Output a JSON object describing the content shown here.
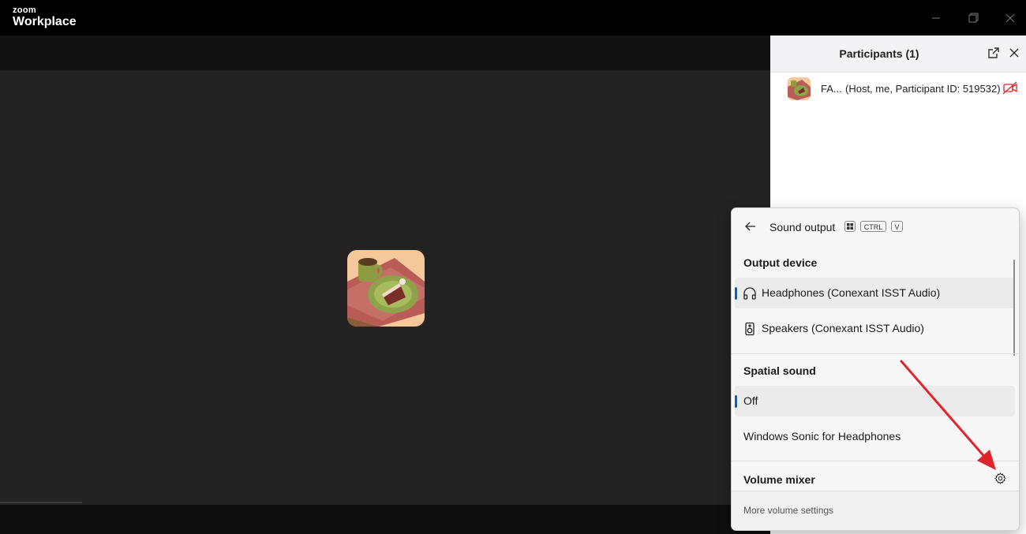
{
  "app": {
    "brand_top": "zoom",
    "brand_bottom": "Workplace"
  },
  "window_controls": {
    "minimize_icon": "minimize-icon",
    "restore_icon": "restore-icon",
    "close_icon": "close-icon"
  },
  "participants": {
    "title": "Participants (1)",
    "list": [
      {
        "name": "FA...",
        "role": "(Host, me, Participant ID: 519532)",
        "video_icon": "video-off-icon"
      }
    ]
  },
  "sound_output": {
    "title": "Sound output",
    "shortcut": [
      "CTRL",
      "V"
    ],
    "output_device_heading": "Output device",
    "devices": [
      {
        "label": "Headphones (Conexant ISST Audio)",
        "icon": "headphones-icon",
        "selected": true
      },
      {
        "label": "Speakers (Conexant ISST Audio)",
        "icon": "speaker-icon",
        "selected": false
      }
    ],
    "spatial_heading": "Spatial sound",
    "spatial_options": [
      {
        "label": "Off",
        "selected": true
      },
      {
        "label": "Windows Sonic for Headphones",
        "selected": false
      }
    ],
    "volume_mixer_heading": "Volume mixer",
    "more_settings": "More volume settings"
  },
  "colors": {
    "accent": "#0067c0",
    "annotation_arrow": "#e0242b"
  }
}
